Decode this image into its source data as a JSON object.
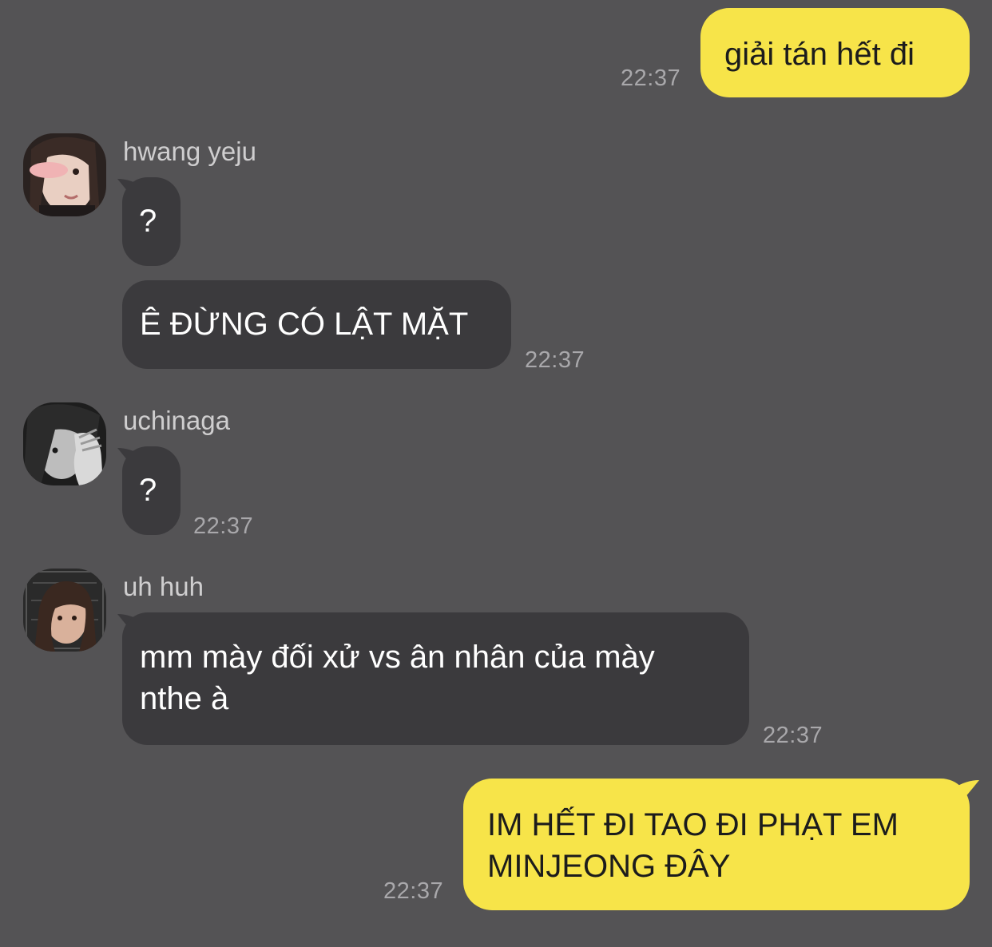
{
  "messages": [
    {
      "sender": "me",
      "text": "giải tán hết đi",
      "time": "22:37"
    },
    {
      "sender": "hwang yeju",
      "avatar": "avatar-photo",
      "text": "?"
    },
    {
      "sender": "hwang yeju",
      "text": "Ê ĐỪNG CÓ LẬT MẶT",
      "time": "22:37"
    },
    {
      "sender": "uchinaga",
      "avatar": "avatar-photo",
      "text": "?",
      "time": "22:37"
    },
    {
      "sender": "uh huh",
      "avatar": "avatar-photo",
      "text_line1": "mm mày đối xử vs ân nhân của mày",
      "text_line2": "nthe à",
      "time": "22:37"
    },
    {
      "sender": "me",
      "text_line1": "IM HẾT ĐI TAO ĐI PHẠT EM",
      "text_line2": "MINJEONG ĐÂY",
      "time": "22:37"
    }
  ],
  "colors": {
    "background": "#545355",
    "outgoing_bubble": "#f7e449",
    "incoming_bubble": "#3b3a3d",
    "timestamp": "#a9a8ab"
  }
}
